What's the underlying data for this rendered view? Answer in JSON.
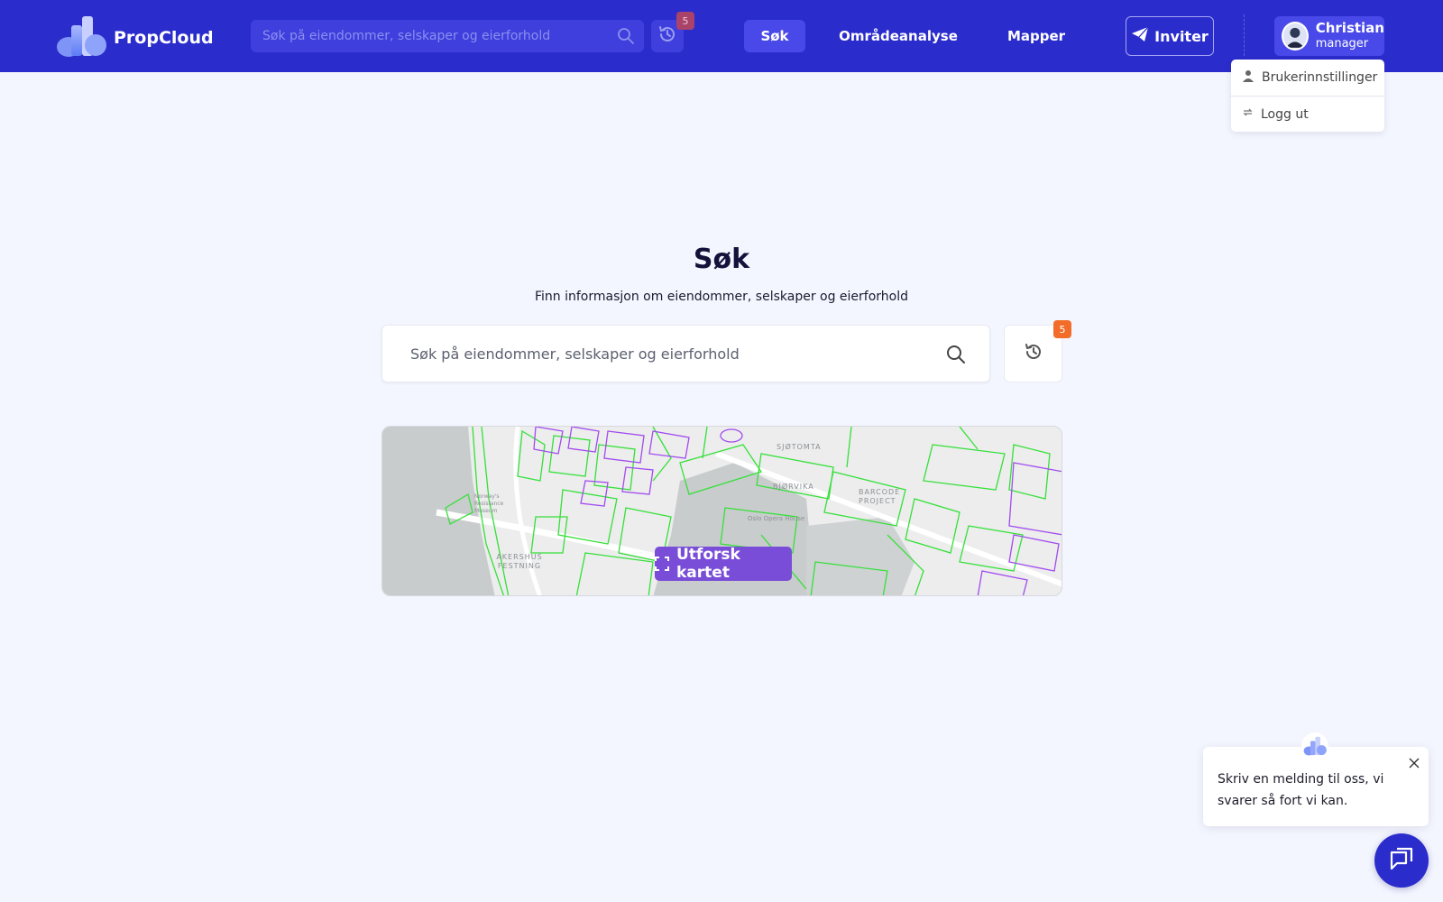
{
  "brand": {
    "name": "PropCloud"
  },
  "header": {
    "search": {
      "placeholder": "Søk på eiendommer, selskaper og eierforhold"
    },
    "history_badge": "5",
    "nav": [
      {
        "label": "Søk",
        "active": true
      },
      {
        "label": "Områdeanalyse",
        "active": false
      },
      {
        "label": "Mapper",
        "active": false
      }
    ],
    "invite_label": "Inviter",
    "user": {
      "name": "Christian",
      "role": "manager"
    }
  },
  "user_menu": {
    "items": [
      {
        "label": "Brukerinnstillinger",
        "icon": "user-icon"
      },
      {
        "label": "Logg ut",
        "icon": "logout-icon"
      }
    ]
  },
  "main": {
    "title": "Søk",
    "subtitle": "Finn informasjon om eiendommer, selskaper og eierforhold",
    "search": {
      "placeholder": "Søk på eiendommer, selskaper og eierforhold"
    },
    "history_badge": "5",
    "map": {
      "labels": [
        "SJØTOMTA",
        "BJØRVIKA",
        "BARCODE PROJECT",
        "Oslo Opera House",
        "Norway's Resistance Museum",
        "AKERSHUS FESTNING"
      ],
      "explore_label": "Utforsk kartet"
    }
  },
  "chat": {
    "message": "Skriv en melding til oss, vi svarer så fort vi kan."
  },
  "colors": {
    "header": "#2b2ccc",
    "accent_purple": "#7a4dd8",
    "badge_orange": "#f26d2a",
    "parcel_green": "#35e03a",
    "parcel_purple": "#a24bf0"
  }
}
